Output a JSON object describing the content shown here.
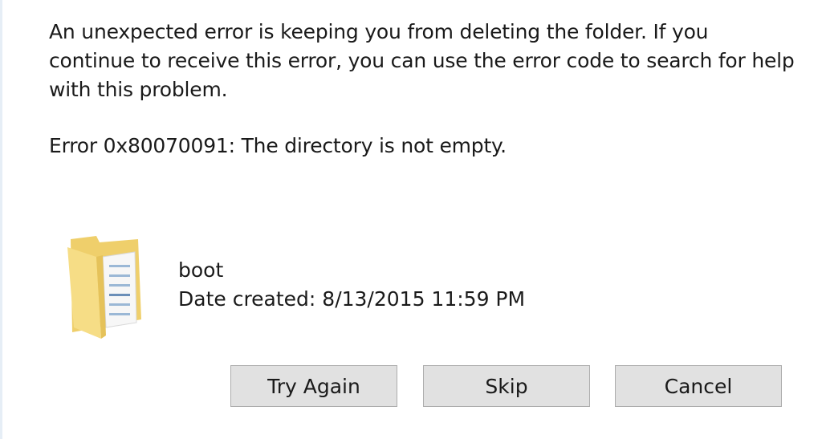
{
  "dialog": {
    "message": "An unexpected error is keeping you from deleting the folder. If you continue to receive this error, you can use the error code to search for help with this problem.",
    "error_line": "Error 0x80070091: The directory is not empty.",
    "item": {
      "icon": "folder-icon",
      "name": "boot",
      "date": "Date created: 8/13/2015 11:59 PM"
    },
    "buttons": {
      "try_again": "Try Again",
      "skip": "Skip",
      "cancel": "Cancel"
    }
  },
  "colors": {
    "folder_fill": "#f3d77a",
    "folder_shadow": "#e5c25a",
    "button_bg": "#e1e1e1",
    "button_border": "#adadad"
  }
}
